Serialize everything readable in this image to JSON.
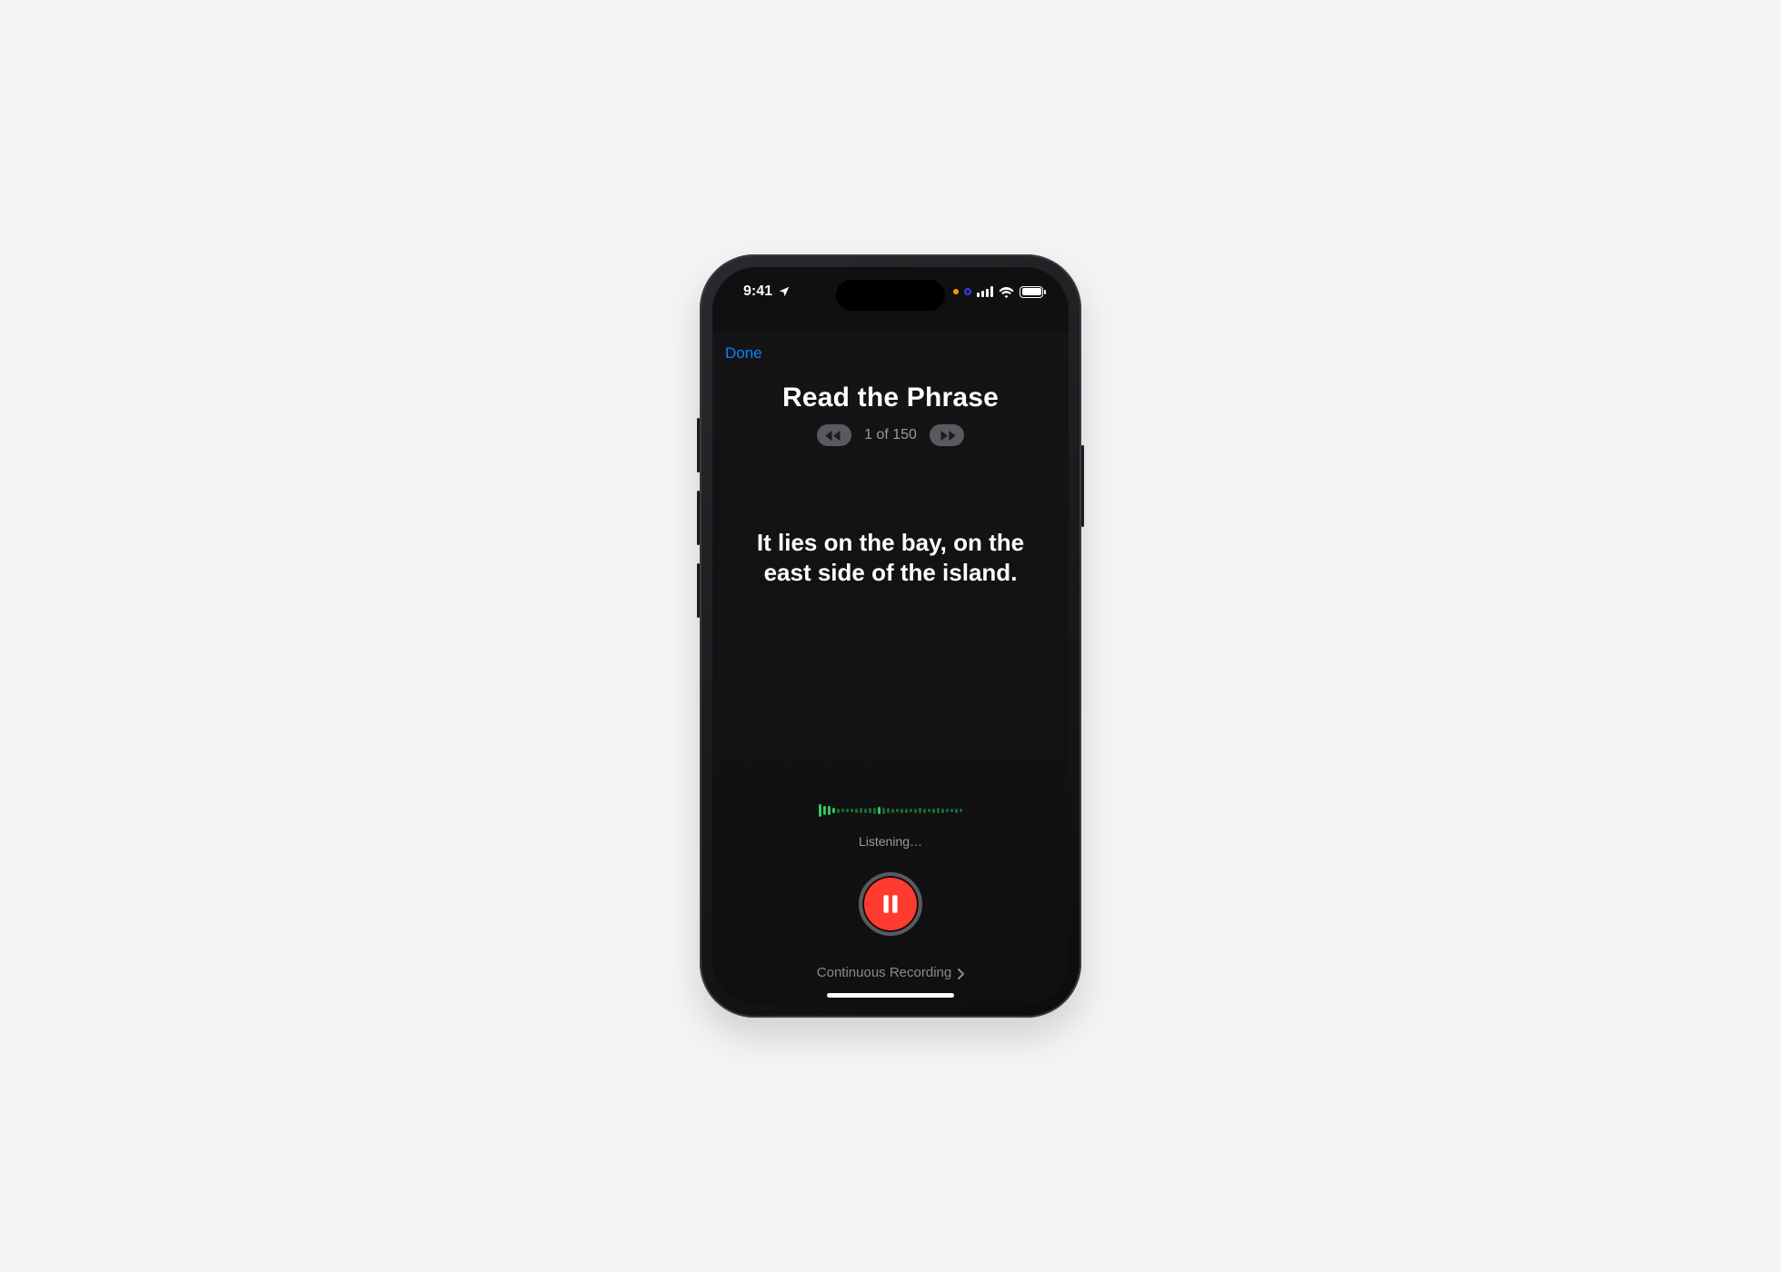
{
  "status_bar": {
    "time": "9:41"
  },
  "nav": {
    "done_label": "Done"
  },
  "header": {
    "title": "Read the Phrase",
    "counter": "1 of 150"
  },
  "phrase": {
    "text": "It lies on the bay, on the east side of the island."
  },
  "recording": {
    "status": "Listening…"
  },
  "footer": {
    "mode_label": "Continuous Recording"
  },
  "colors": {
    "accent": "#0a84ff",
    "record": "#ff3b30",
    "wave_high": "#34c759",
    "wave_low": "#196b2f"
  },
  "waveform": {
    "bars": [
      14,
      10,
      10,
      6,
      5,
      4,
      4,
      4,
      5,
      6,
      5,
      6,
      7,
      8,
      7,
      6,
      5,
      4,
      5,
      5,
      4,
      5,
      6,
      5,
      4,
      5,
      6,
      5,
      4,
      4,
      5,
      4
    ]
  }
}
